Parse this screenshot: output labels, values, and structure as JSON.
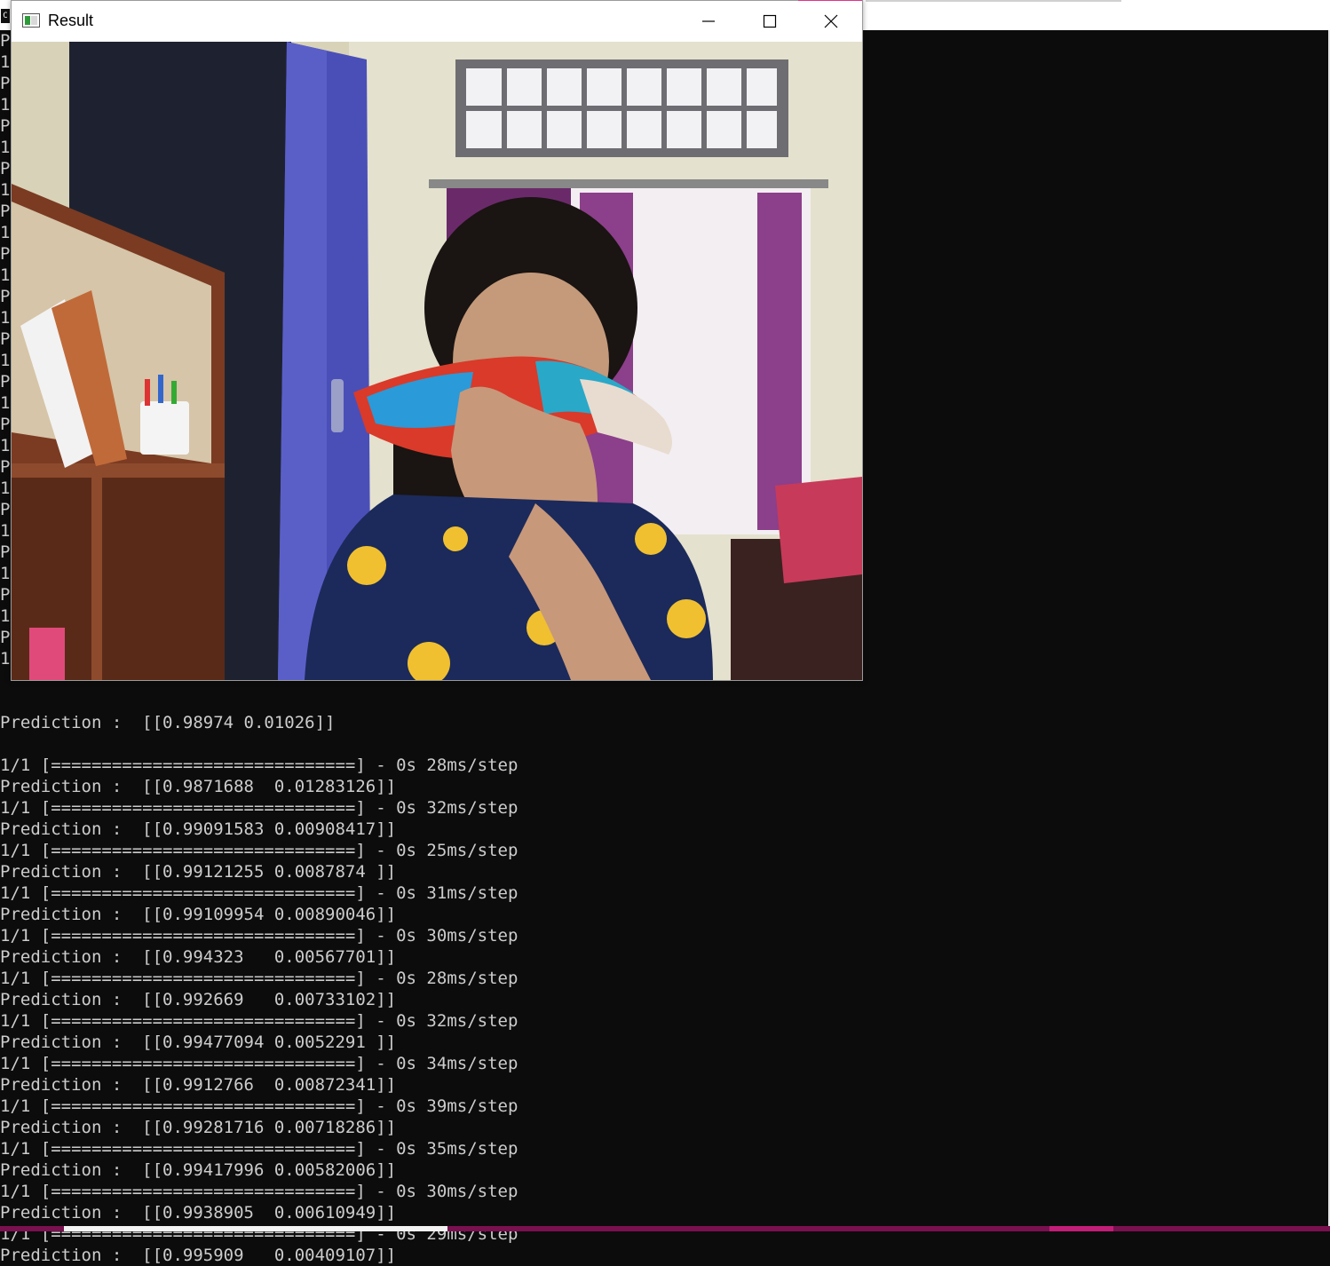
{
  "console_window": {
    "icon_text": "C",
    "left_margin_chars": [
      "P",
      "1",
      "P",
      "1",
      "P",
      "1",
      "P",
      "1",
      "P",
      "1",
      "P",
      "1",
      "P",
      "1",
      "P",
      "1",
      "P",
      "1",
      "P",
      "1",
      "P",
      "1",
      "P",
      "1",
      "P",
      "1",
      "P",
      "1",
      "P",
      "1"
    ],
    "partial_line": "Prediction :  [[0.98974 0.01026]]",
    "lines": [
      "1/1 [==============================] - 0s 28ms/step",
      "Prediction :  [[0.9871688  0.01283126]]",
      "1/1 [==============================] - 0s 32ms/step",
      "Prediction :  [[0.99091583 0.00908417]]",
      "1/1 [==============================] - 0s 25ms/step",
      "Prediction :  [[0.99121255 0.0087874 ]]",
      "1/1 [==============================] - 0s 31ms/step",
      "Prediction :  [[0.99109954 0.00890046]]",
      "1/1 [==============================] - 0s 30ms/step",
      "Prediction :  [[0.994323   0.00567701]]",
      "1/1 [==============================] - 0s 28ms/step",
      "Prediction :  [[0.992669   0.00733102]]",
      "1/1 [==============================] - 0s 32ms/step",
      "Prediction :  [[0.99477094 0.0052291 ]]",
      "1/1 [==============================] - 0s 34ms/step",
      "Prediction :  [[0.9912766  0.00872341]]",
      "1/1 [==============================] - 0s 39ms/step",
      "Prediction :  [[0.99281716 0.00718286]]",
      "1/1 [==============================] - 0s 35ms/step",
      "Prediction :  [[0.99417996 0.00582006]]",
      "1/1 [==============================] - 0s 30ms/step",
      "Prediction :  [[0.9938905  0.00610949]]",
      "1/1 [==============================] - 0s 29ms/step",
      "Prediction :  [[0.995909   0.00409107]]"
    ]
  },
  "result_window": {
    "title": "Result",
    "icons": {
      "app": "window-app-icon",
      "minimize": "minimize-icon",
      "maximize": "maximize-icon",
      "close": "close-icon"
    }
  },
  "colors": {
    "console_bg": "#0c0c0c",
    "console_text": "#cccccc",
    "taskbar": "#7a1050",
    "accent_pink": "#e0338c"
  }
}
